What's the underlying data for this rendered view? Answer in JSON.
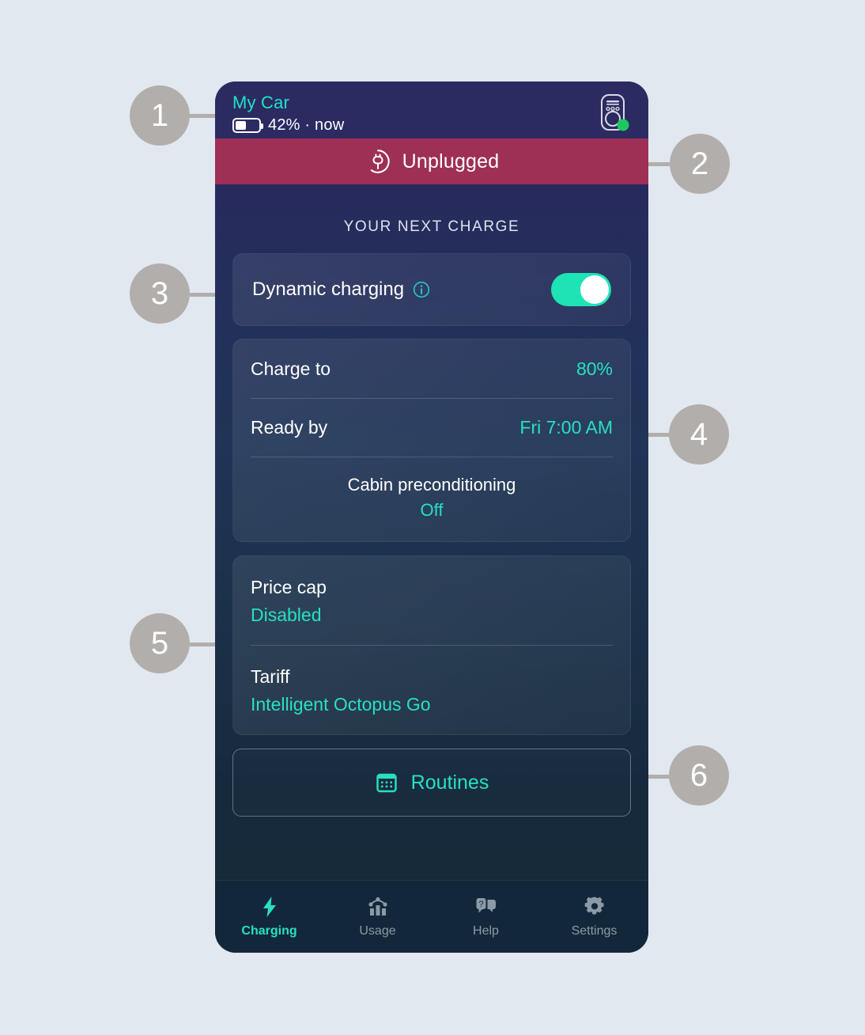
{
  "app": {
    "header": {
      "car_name": "My Car",
      "battery_percent": "42%",
      "battery_level": 42,
      "separator": "·",
      "timestamp": "now",
      "charger_icon": "wallbox-charger-icon",
      "charger_status_color": "#1ec860"
    },
    "banner": {
      "label": "Unplugged",
      "icon": "plug-unplugged-icon",
      "background": "#9e2f55"
    },
    "section_title": "YOUR NEXT CHARGE",
    "dynamic_charging": {
      "label": "Dynamic charging",
      "info_icon": "info-circle-icon",
      "toggle_state": "on",
      "toggle_color": "#1ee3b4"
    },
    "charge_settings": {
      "rows": [
        {
          "label": "Charge to",
          "value": "80%"
        },
        {
          "label": "Ready by",
          "value": "Fri 7:00 AM"
        }
      ],
      "preconditioning": {
        "label": "Cabin preconditioning",
        "value": "Off"
      }
    },
    "tariff_settings": {
      "items": [
        {
          "label": "Price cap",
          "value": "Disabled"
        },
        {
          "label": "Tariff",
          "value": "Intelligent Octopus Go"
        }
      ]
    },
    "routines": {
      "label": "Routines",
      "icon": "calendar-icon"
    },
    "nav": {
      "items": [
        {
          "label": "Charging",
          "icon": "lightning-bolt-icon",
          "active": true
        },
        {
          "label": "Usage",
          "icon": "bar-chart-icon",
          "active": false
        },
        {
          "label": "Help",
          "icon": "chat-question-icon",
          "active": false
        },
        {
          "label": "Settings",
          "icon": "gear-icon",
          "active": false
        }
      ]
    },
    "accent_color": "#28e0c0",
    "background_top": "#2b2b62",
    "background_bottom": "#142938"
  },
  "annotations": {
    "markers": [
      {
        "number": "1"
      },
      {
        "number": "2"
      },
      {
        "number": "3"
      },
      {
        "number": "4"
      },
      {
        "number": "5"
      },
      {
        "number": "6"
      }
    ]
  }
}
